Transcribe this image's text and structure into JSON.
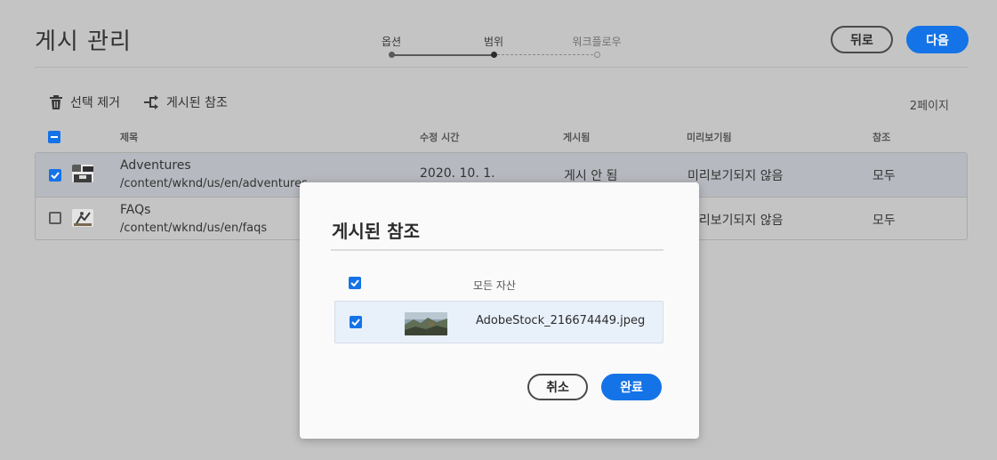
{
  "page": {
    "title": "게시 관리"
  },
  "stepper": {
    "steps": [
      {
        "label": "옵션",
        "state": "done"
      },
      {
        "label": "범위",
        "state": "active"
      },
      {
        "label": "워크플로우",
        "state": "todo"
      }
    ]
  },
  "header_buttons": {
    "back_label": "뒤로",
    "next_label": "다음"
  },
  "toolbar": {
    "remove_selection_label": "선택 제거",
    "published_references_label": "게시된 참조",
    "page_count": "2페이지"
  },
  "table": {
    "columns": {
      "title": "제목",
      "modified": "수정 시간",
      "published": "게시됨",
      "previewed": "미리보기됨",
      "references": "참조"
    },
    "rows": [
      {
        "title": "Adventures",
        "path": "/content/wknd/us/en/adventures",
        "modified": "2020. 10. 1.",
        "published": "게시 안 됨",
        "previewed": "미리보기되지 않음",
        "references": "모두",
        "selected": true
      },
      {
        "title": "FAQs",
        "path": "/content/wknd/us/en/faqs",
        "modified": "",
        "published": "",
        "previewed": "미리보기되지 않음",
        "references": "모두",
        "selected": false
      }
    ]
  },
  "dialog": {
    "title": "게시된 참조",
    "all_assets_label": "모든 자산",
    "asset_file": "AdobeStock_216674449.jpeg",
    "cancel_label": "취소",
    "done_label": "완료"
  },
  "colors": {
    "accent": "#1473e6",
    "backdrop": "#c4c4c4",
    "selected_row": "#b6b9bf"
  }
}
